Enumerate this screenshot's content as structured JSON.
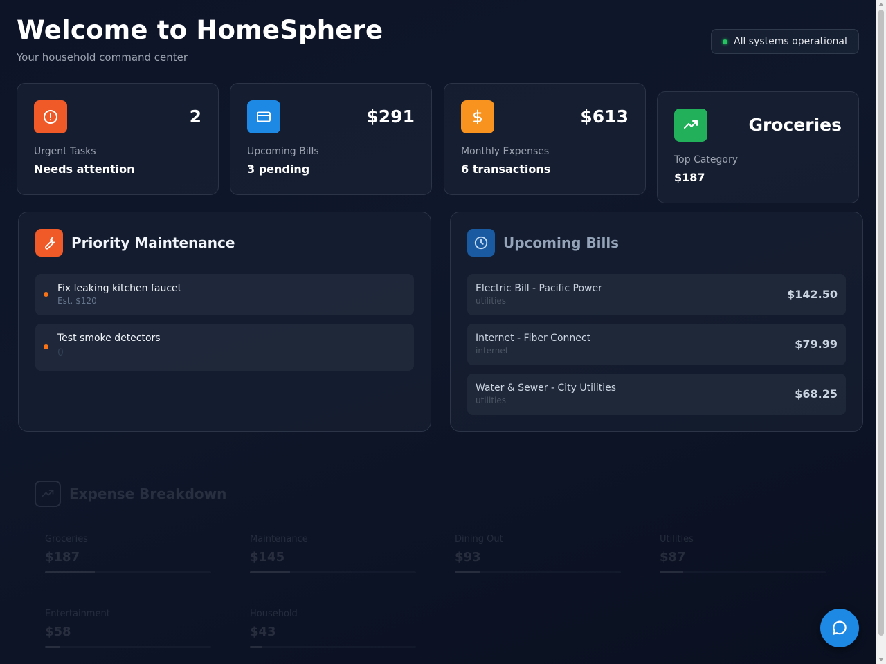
{
  "header": {
    "title": "Welcome to HomeSphere",
    "subtitle": "Your household command center",
    "status": "All systems operational"
  },
  "stats": [
    {
      "value": "2",
      "label": "Urgent Tasks",
      "sub": "Needs attention",
      "icon": "alert-circle-icon",
      "color": "#f05a28"
    },
    {
      "value": "$291",
      "label": "Upcoming Bills",
      "sub": "3 pending",
      "icon": "credit-card-icon",
      "color": "#1e88e5"
    },
    {
      "value": "$613",
      "label": "Monthly Expenses",
      "sub": "6 transactions",
      "icon": "dollar-icon",
      "color": "#f7931e"
    },
    {
      "value": "Groceries",
      "label": "Top Category",
      "sub": "$187",
      "icon": "trending-up-icon",
      "color": "#22b05b"
    }
  ],
  "maintenance": {
    "title": "Priority Maintenance",
    "items": [
      {
        "name": "Fix leaking kitchen faucet",
        "meta": "Est. $120"
      },
      {
        "name": "Test smoke detectors",
        "meta": "0"
      }
    ]
  },
  "bills": {
    "title": "Upcoming Bills",
    "items": [
      {
        "name": "Electric Bill - Pacific Power",
        "category": "utilities",
        "amount": "$142.50"
      },
      {
        "name": "Internet - Fiber Connect",
        "category": "internet",
        "amount": "$79.99"
      },
      {
        "name": "Water & Sewer - City Utilities",
        "category": "utilities",
        "amount": "$68.25"
      }
    ]
  },
  "expenses": {
    "title": "Expense Breakdown",
    "categories": [
      {
        "name": "Groceries",
        "amount": "$187",
        "fraction": 0.3
      },
      {
        "name": "Maintenance",
        "amount": "$145",
        "fraction": 0.24
      },
      {
        "name": "Dining Out",
        "amount": "$93",
        "fraction": 0.15
      },
      {
        "name": "Utilities",
        "amount": "$87",
        "fraction": 0.14
      },
      {
        "name": "Entertainment",
        "amount": "$58",
        "fraction": 0.09
      },
      {
        "name": "Household",
        "amount": "$43",
        "fraction": 0.07
      }
    ]
  }
}
